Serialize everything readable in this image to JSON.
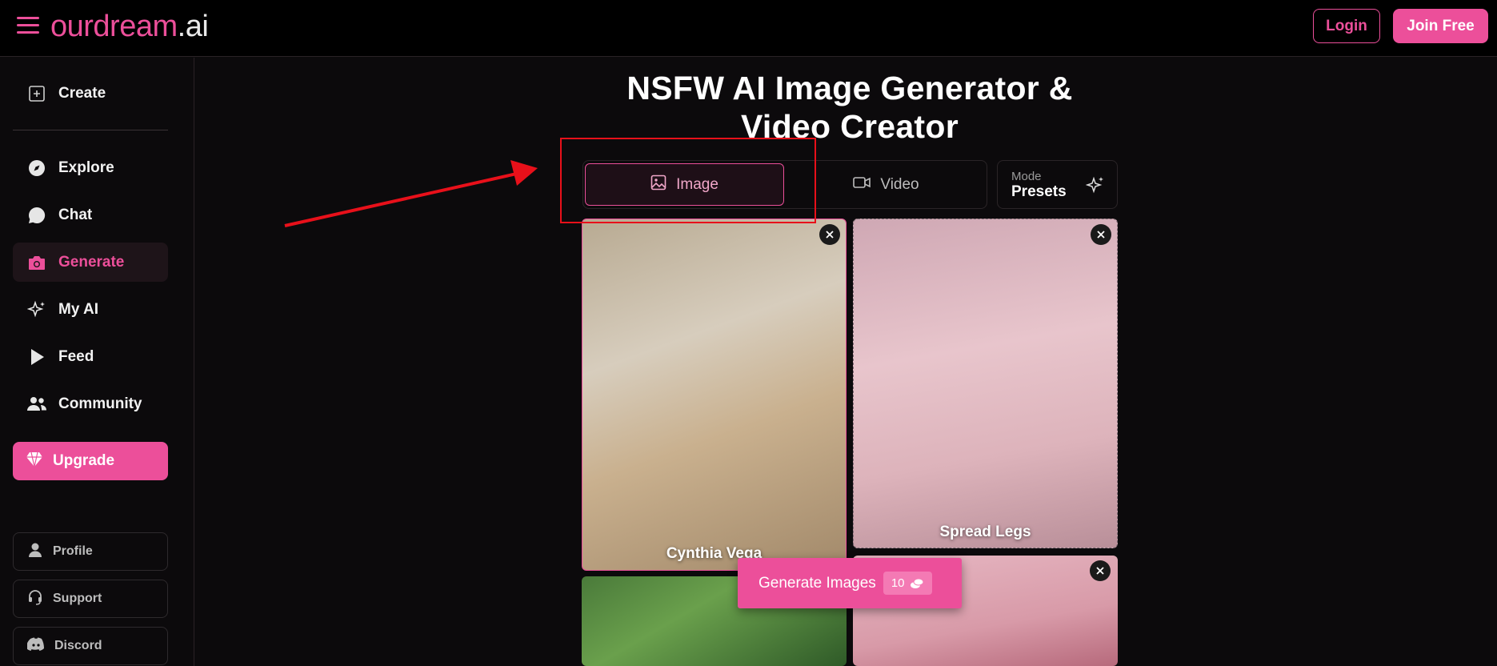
{
  "header": {
    "logo_brand": "ourdream",
    "logo_tld": ".ai",
    "login_label": "Login",
    "join_label": "Join Free"
  },
  "sidebar": {
    "items": [
      {
        "label": "Create",
        "icon": "plus-square-icon"
      },
      {
        "label": "Explore",
        "icon": "compass-icon"
      },
      {
        "label": "Chat",
        "icon": "chat-bubble-icon"
      },
      {
        "label": "Generate",
        "icon": "camera-icon",
        "active": true
      },
      {
        "label": "My AI",
        "icon": "sparkle-icon"
      },
      {
        "label": "Feed",
        "icon": "play-icon"
      },
      {
        "label": "Community",
        "icon": "users-icon"
      }
    ],
    "upgrade_label": "Upgrade",
    "sub_items": [
      {
        "label": "Profile",
        "icon": "user-icon"
      },
      {
        "label": "Support",
        "icon": "headset-icon"
      },
      {
        "label": "Discord",
        "icon": "discord-icon"
      }
    ]
  },
  "main": {
    "title_line1": "NSFW AI Image Generator &",
    "title_line2": "Video Creator",
    "tabs": [
      {
        "label": "Image",
        "icon": "image-icon",
        "selected": true
      },
      {
        "label": "Video",
        "icon": "video-camera-icon",
        "selected": false
      }
    ],
    "mode": {
      "caption": "Mode",
      "value": "Presets"
    },
    "cards": [
      {
        "caption": "Cynthia Vega"
      },
      {
        "caption": "Spread Legs"
      },
      {
        "caption": ""
      },
      {
        "caption": ""
      }
    ],
    "generate": {
      "label": "Generate Images",
      "count": "10"
    }
  },
  "colors": {
    "accent": "#ec4f9a",
    "background": "#0c0a0c",
    "annotation": "#e8101a"
  }
}
